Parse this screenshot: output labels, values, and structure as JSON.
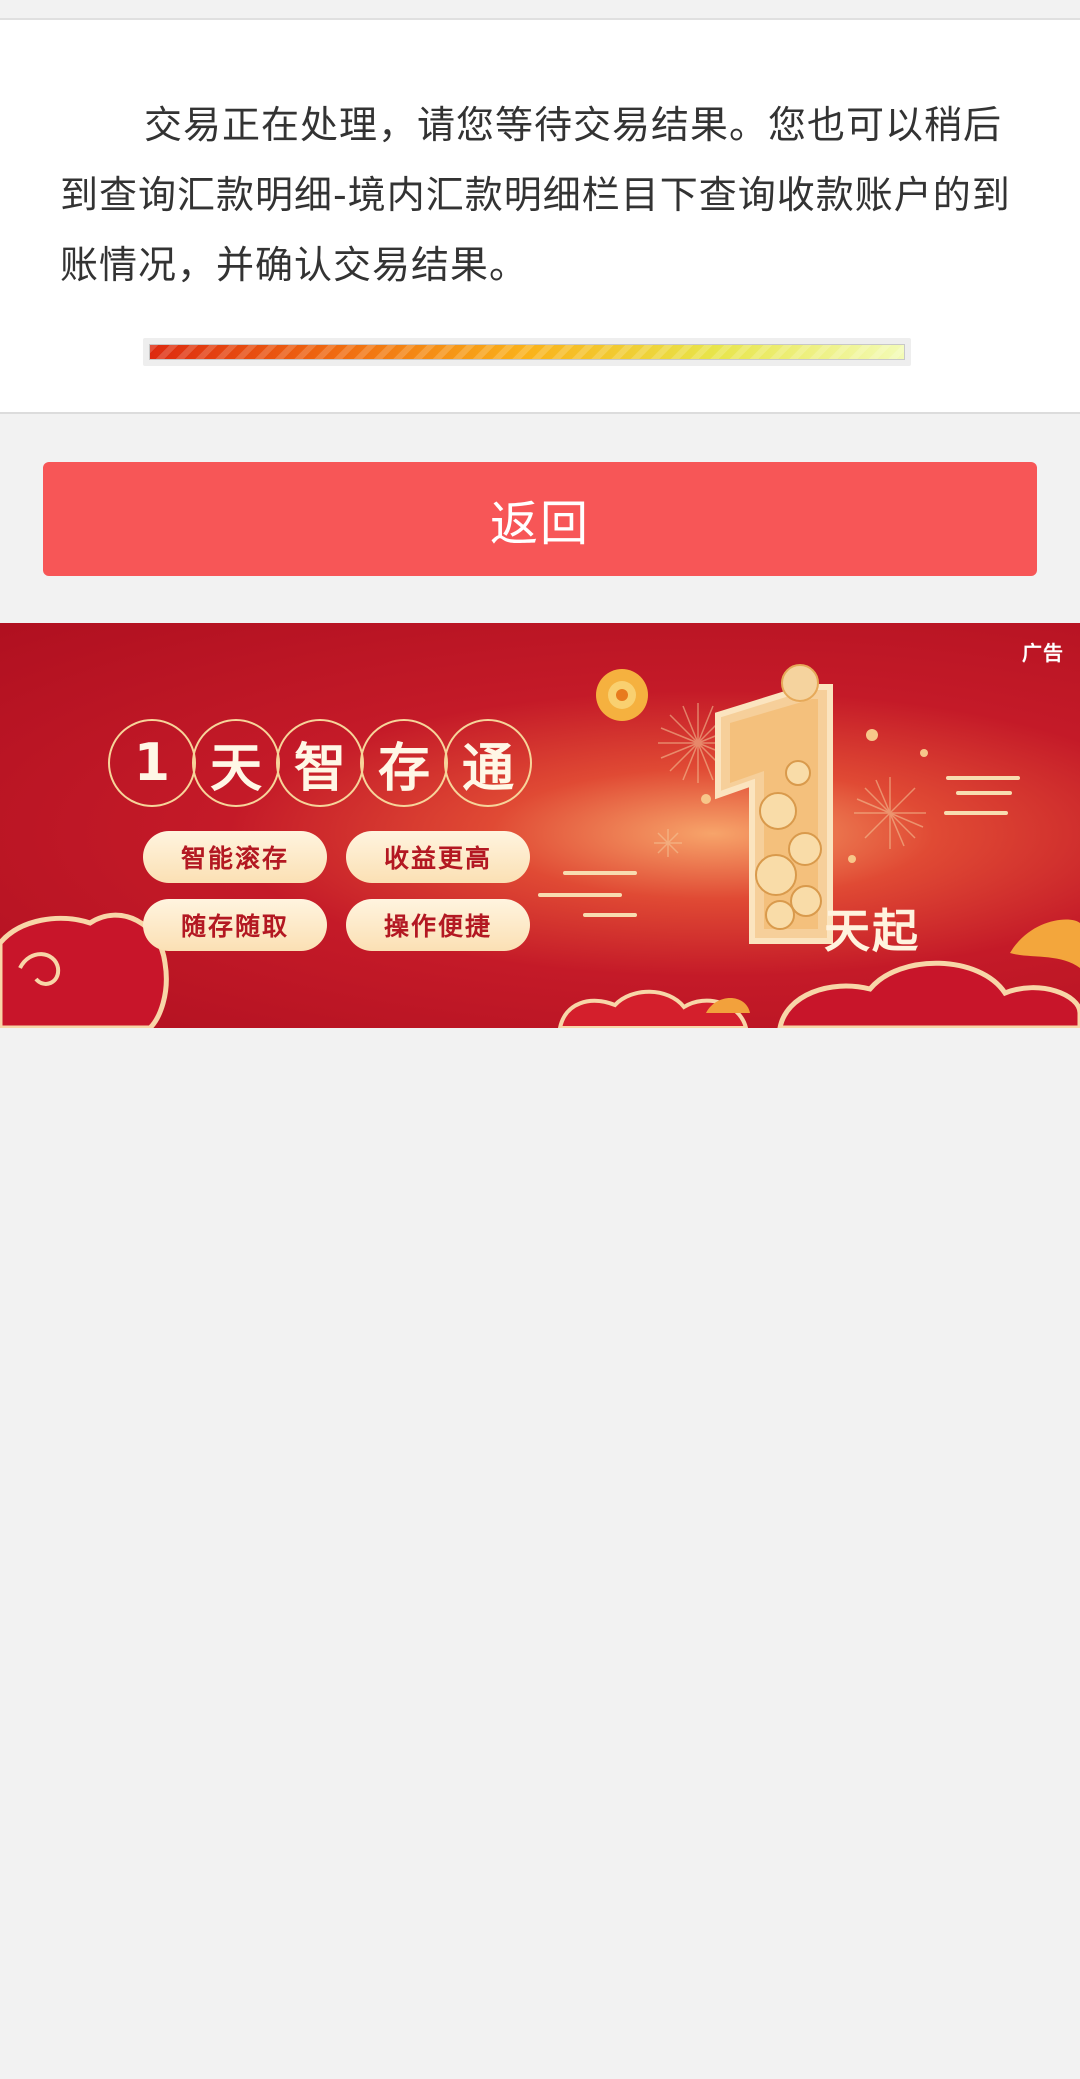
{
  "message": {
    "text": "交易正在处理，请您等待交易结果。您也可以稍后到查询汇款明细-境内汇款明细栏目下查询收款账户的到账情况，并确认交易结果。"
  },
  "progress": {
    "fraction": 1.0
  },
  "actions": {
    "back_label": "返回"
  },
  "ad": {
    "tag": "广告",
    "title_chars": [
      "1",
      "天",
      "智",
      "存",
      "通"
    ],
    "features": [
      "智能滚存",
      "收益更高",
      "随存随取",
      "操作便捷"
    ],
    "big_number": "1",
    "big_number_suffix": "天起"
  },
  "colors": {
    "button_bg": "#f75657",
    "ad_bg": "#c41a28",
    "page_bg": "#f2f2f2"
  }
}
